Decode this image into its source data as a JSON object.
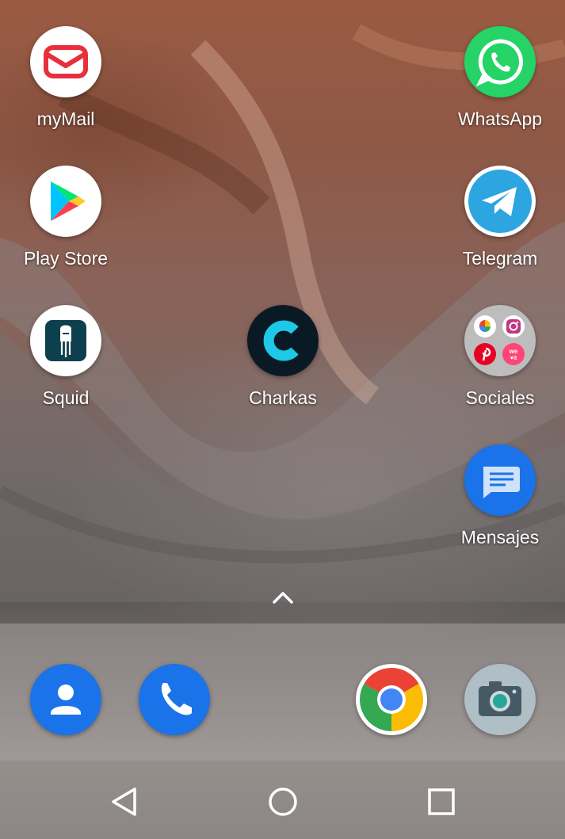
{
  "home": {
    "apps": [
      {
        "label": "myMail",
        "icon": "mymail-envelope-icon"
      },
      {
        "label": "WhatsApp",
        "icon": "whatsapp-phone-bubble-icon"
      },
      {
        "label": "Play Store",
        "icon": "play-store-triangle-icon"
      },
      {
        "label": "Telegram",
        "icon": "telegram-paper-plane-icon"
      },
      {
        "label": "Squid",
        "icon": "squid-icon"
      },
      {
        "label": "Charkas",
        "icon": "charkas-c-icon"
      },
      {
        "label": "Sociales",
        "icon": "folder-icon"
      },
      {
        "label": "Mensajes",
        "icon": "message-bubble-icon"
      }
    ],
    "folder_apps": [
      "google-photos-icon",
      "instagram-icon",
      "pinterest-icon",
      "weheartit-icon"
    ],
    "folder_weheartit_text": "we ♥it",
    "drawer_handle_icon": "chevron-up-icon"
  },
  "dock": {
    "apps": [
      "contacts-icon",
      "phone-icon",
      "chrome-icon",
      "camera-icon"
    ]
  },
  "navbar": {
    "buttons": [
      "back-triangle-icon",
      "home-circle-icon",
      "recents-square-icon"
    ]
  },
  "colors": {
    "mymail_red": "#e8303c",
    "whatsapp_green": "#25d366",
    "telegram_blue": "#2ca5e0",
    "google_blue": "#1a73e8",
    "label_text": "#ffffff"
  }
}
